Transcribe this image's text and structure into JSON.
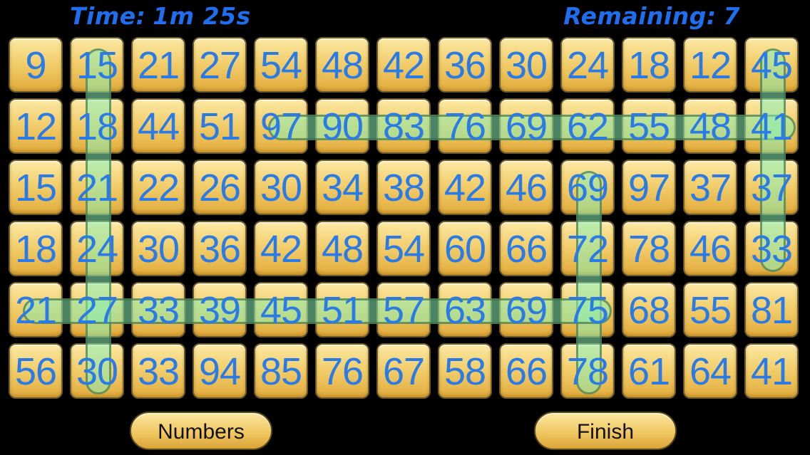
{
  "hud": {
    "time_label": "Time:",
    "time_value": "1m 25s",
    "remaining_label": "Remaining:",
    "remaining_value": "7"
  },
  "grid": {
    "rows": [
      [
        "9",
        "15",
        "21",
        "27",
        "54",
        "48",
        "42",
        "36",
        "30",
        "24",
        "18",
        "12",
        "45"
      ],
      [
        "12",
        "18",
        "44",
        "51",
        "97",
        "90",
        "83",
        "76",
        "69",
        "62",
        "55",
        "48",
        "41"
      ],
      [
        "15",
        "21",
        "22",
        "26",
        "30",
        "34",
        "38",
        "42",
        "46",
        "69",
        "97",
        "37",
        "37"
      ],
      [
        "18",
        "24",
        "30",
        "36",
        "42",
        "48",
        "54",
        "60",
        "66",
        "72",
        "78",
        "46",
        "33"
      ],
      [
        "21",
        "27",
        "33",
        "39",
        "45",
        "51",
        "57",
        "63",
        "69",
        "75",
        "68",
        "55",
        "81"
      ],
      [
        "56",
        "30",
        "33",
        "94",
        "85",
        "76",
        "67",
        "58",
        "66",
        "78",
        "61",
        "64",
        "41"
      ]
    ]
  },
  "found_sequences": [
    {
      "from": {
        "row": 0,
        "col": 1
      },
      "to": {
        "row": 5,
        "col": 1
      }
    },
    {
      "from": {
        "row": 1,
        "col": 4
      },
      "to": {
        "row": 1,
        "col": 12
      }
    },
    {
      "from": {
        "row": 0,
        "col": 12
      },
      "to": {
        "row": 3,
        "col": 12
      }
    },
    {
      "from": {
        "row": 2,
        "col": 9
      },
      "to": {
        "row": 5,
        "col": 9
      }
    },
    {
      "from": {
        "row": 4,
        "col": 0
      },
      "to": {
        "row": 4,
        "col": 9
      }
    }
  ],
  "buttons": {
    "numbers": "Numbers",
    "finish": "Finish"
  },
  "colors": {
    "background": "#000000",
    "hud_text": "#1e6ff0",
    "number_text": "#2a7be6",
    "tile": "#f3cf6e",
    "selection": "#8aeeb4"
  }
}
